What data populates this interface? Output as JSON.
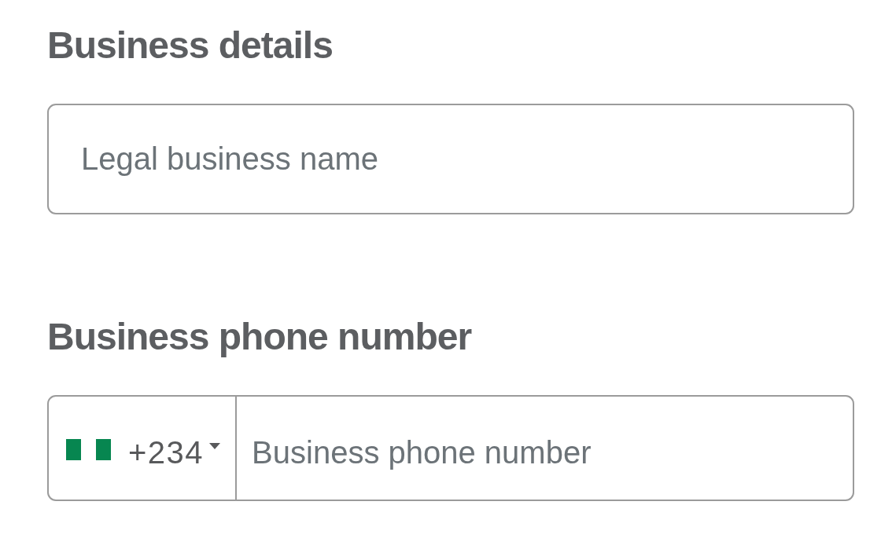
{
  "sections": [
    {
      "heading": "Business details",
      "field": {
        "kind": "text",
        "placeholder": "Legal business name"
      }
    },
    {
      "heading": "Business phone number",
      "field": {
        "kind": "phone",
        "country_code": "+234",
        "placeholder": "Business phone number"
      }
    }
  ]
}
